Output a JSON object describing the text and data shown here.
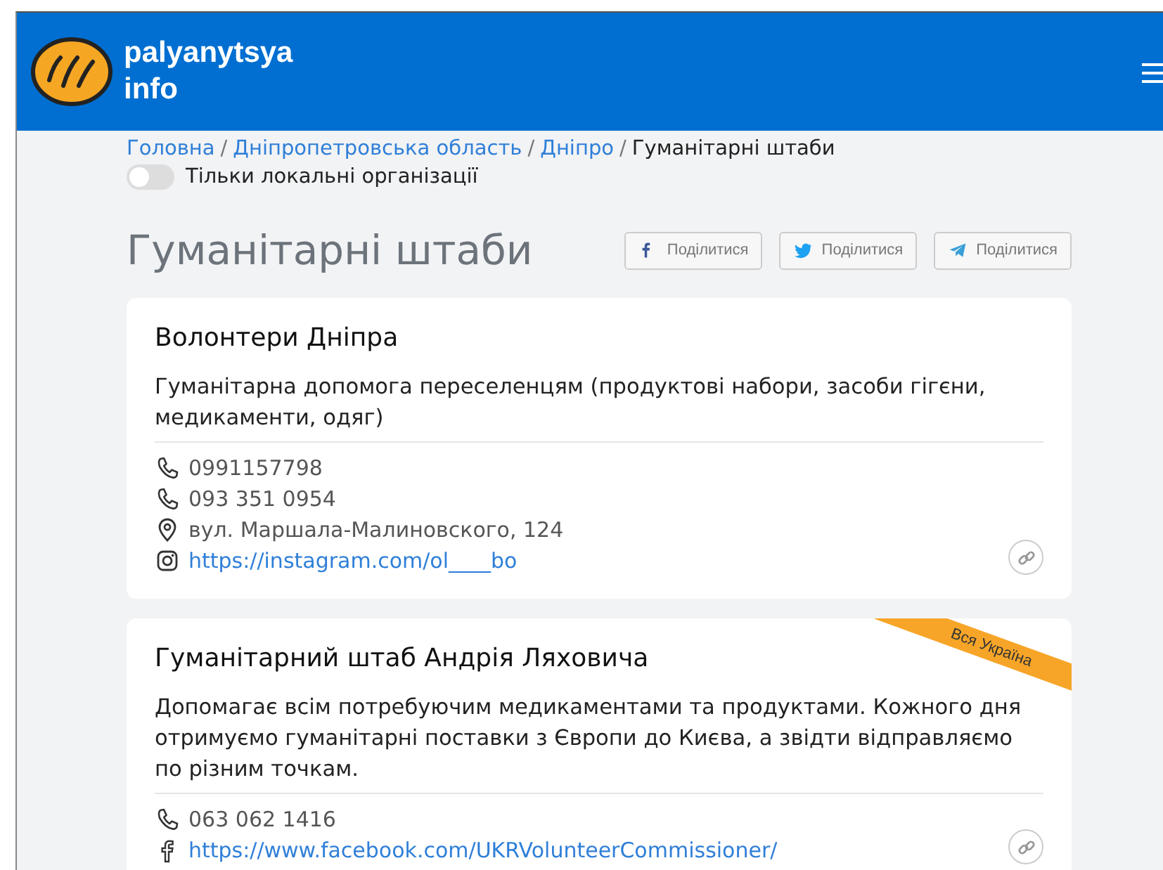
{
  "header": {
    "logo_line_1": "palyanytsya",
    "logo_line_2": "info"
  },
  "breadcrumb": [
    {
      "label": "Головна",
      "kind": "link"
    },
    {
      "label": "/",
      "kind": "separator"
    },
    {
      "label": "Дніпропетровська область",
      "kind": "link"
    },
    {
      "label": "/",
      "kind": "separator"
    },
    {
      "label": "Дніпро",
      "kind": "link"
    },
    {
      "label": "/",
      "kind": "separator"
    },
    {
      "label": "Гуманітарні штаби",
      "kind": "current"
    }
  ],
  "filter": {
    "label": "Тільки локальні організації",
    "on": false
  },
  "page_title": "Гуманітарні штаби",
  "share_buttons": [
    {
      "label": "Поділитися",
      "kind": "facebook"
    },
    {
      "label": "Поділитися",
      "kind": "twitter"
    },
    {
      "label": "Поділитися",
      "kind": "telegram"
    }
  ],
  "cards": [
    {
      "title": "Волонтери Дніпра",
      "description": "Гуманітарна допомога переселенцям (продуктові набори, засоби гігєни, медикаменти, одяг)",
      "contacts": [
        {
          "kind": "phone",
          "text": "0991157798"
        },
        {
          "kind": "phone",
          "text": "093 351 0954"
        },
        {
          "kind": "address",
          "text": "вул. Маршала-Малиновского, 124"
        },
        {
          "kind": "instagram",
          "text": "https://instagram.com/ol____bo"
        }
      ]
    },
    {
      "title": "Гуманітарний штаб Андрія Ляховича",
      "ribbon": "Вся Україна",
      "description": "Допомагає всім потребуючим медикаментами та продуктами. Кожного дня отримуємо гуманітарні поставки з Європи до Києва, а звідти відправляємо по різним точкам.",
      "contacts": [
        {
          "kind": "phone",
          "text": "063 062 1416"
        },
        {
          "kind": "facebook",
          "text": "https://www.facebook.com/UKRVolunteerCommissioner/"
        }
      ]
    }
  ]
}
